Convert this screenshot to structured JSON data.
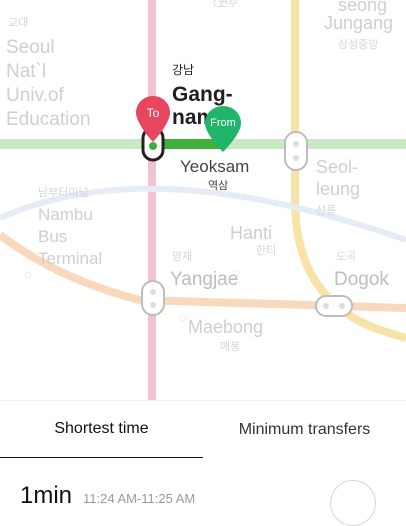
{
  "map": {
    "stations": {
      "top_partial_ko": "연주",
      "seoul_univ_ko": "교대",
      "seoul_univ": [
        "Seoul",
        "Nat`l",
        "Univ.of",
        "Education"
      ],
      "seong_partial": "seong",
      "jungang": "Jungang",
      "jungang_ko": "삼성중앙",
      "gangnam_ko": "강남",
      "gangnam": [
        "Gang-",
        "nam"
      ],
      "yeoksam": "Yeoksam",
      "yeoksam_ko": "역삼",
      "seolleung": [
        "Seol-",
        "leung"
      ],
      "seolleung_ko": "선릉",
      "nambu_ko": "남부터미널",
      "nambu": [
        "Nambu",
        "Bus",
        "Terminal"
      ],
      "hanti": "Hanti",
      "hanti_ko": "한티",
      "yangjae_ko": "양재",
      "yangjae": "Yangjae",
      "dogok_ko": "도곡",
      "dogok": "Dogok",
      "maebong": "Maebong",
      "maebong_ko": "매봉"
    },
    "markers": {
      "to_label": "To",
      "from_label": "From",
      "to_color": "#e8455f",
      "from_color": "#21b46b"
    },
    "line_colors": {
      "line2_green": "#3fb13b",
      "line3_orange": "#f5a25b",
      "line_pink": "#e46a86",
      "line_yellow": "#f4c542",
      "line_blue": "#8fa8d8"
    }
  },
  "tabs": {
    "shortest_time": "Shortest time",
    "minimum_transfers": "Minimum transfers"
  },
  "result": {
    "duration": "1min",
    "times": "11:24 AM-11:25 AM"
  }
}
